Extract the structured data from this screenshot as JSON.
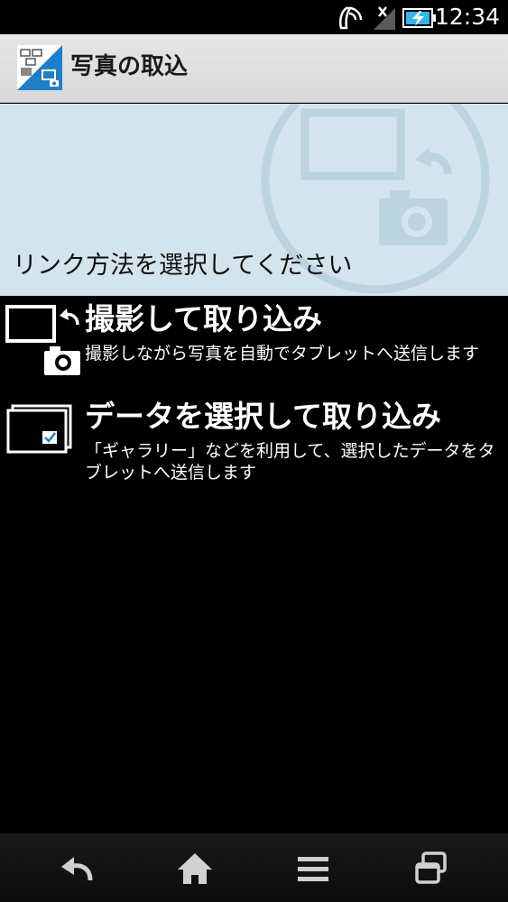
{
  "status_bar": {
    "time": "12:34",
    "icons": [
      "nfc-icon",
      "no-signal-icon",
      "battery-charging-icon"
    ]
  },
  "action_bar": {
    "title": "写真の取込",
    "icon": "photo-import-app-icon"
  },
  "banner": {
    "prompt": "リンク方法を選択してください"
  },
  "options": [
    {
      "title": "撮影して取り込み",
      "description": "撮影しながら写真を自動でタブレットへ送信します",
      "icon": "tablet-camera-icon"
    },
    {
      "title": "データを選択して取り込み",
      "description": "「ギャラリー」などを利用して、選択したデータをタブレットへ送信します",
      "icon": "select-data-icon"
    }
  ],
  "nav_bar": {
    "buttons": [
      "back-icon",
      "home-icon",
      "menu-icon",
      "recent-apps-icon"
    ]
  },
  "colors": {
    "banner_bg": "#d4e4ee",
    "action_bar_bg": "#e0e0e0",
    "app_icon_blue": "#1e7fc9",
    "background": "#000000"
  }
}
